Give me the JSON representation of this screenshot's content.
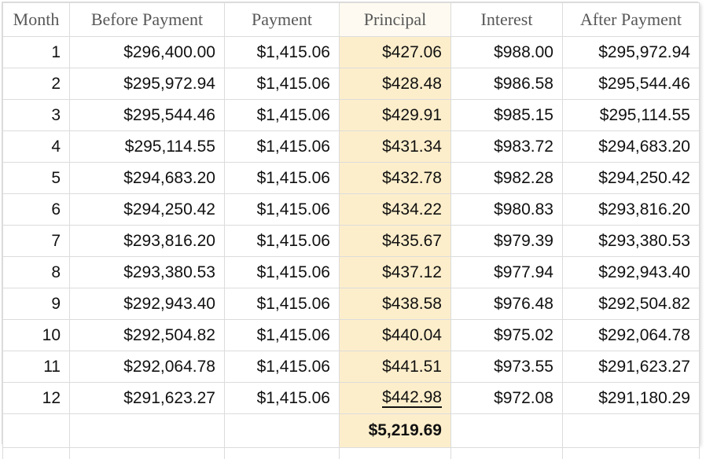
{
  "table": {
    "columns": [
      {
        "key": "month",
        "label": "Month",
        "align": "right",
        "highlight": false
      },
      {
        "key": "before",
        "label": "Before Payment",
        "align": "right",
        "highlight": false
      },
      {
        "key": "payment",
        "label": "Payment",
        "align": "right",
        "highlight": false
      },
      {
        "key": "principal",
        "label": "Principal",
        "align": "right",
        "highlight": true
      },
      {
        "key": "interest",
        "label": "Interest",
        "align": "right",
        "highlight": false
      },
      {
        "key": "after",
        "label": "After Payment",
        "align": "right",
        "highlight": false
      }
    ],
    "rows": [
      {
        "month": "1",
        "before": "$296,400.00",
        "payment": "$1,415.06",
        "principal": "$427.06",
        "interest": "$988.00",
        "after": "$295,972.94"
      },
      {
        "month": "2",
        "before": "$295,972.94",
        "payment": "$1,415.06",
        "principal": "$428.48",
        "interest": "$986.58",
        "after": "$295,544.46"
      },
      {
        "month": "3",
        "before": "$295,544.46",
        "payment": "$1,415.06",
        "principal": "$429.91",
        "interest": "$985.15",
        "after": "$295,114.55"
      },
      {
        "month": "4",
        "before": "$295,114.55",
        "payment": "$1,415.06",
        "principal": "$431.34",
        "interest": "$983.72",
        "after": "$294,683.20"
      },
      {
        "month": "5",
        "before": "$294,683.20",
        "payment": "$1,415.06",
        "principal": "$432.78",
        "interest": "$982.28",
        "after": "$294,250.42"
      },
      {
        "month": "6",
        "before": "$294,250.42",
        "payment": "$1,415.06",
        "principal": "$434.22",
        "interest": "$980.83",
        "after": "$293,816.20"
      },
      {
        "month": "7",
        "before": "$293,816.20",
        "payment": "$1,415.06",
        "principal": "$435.67",
        "interest": "$979.39",
        "after": "$293,380.53"
      },
      {
        "month": "8",
        "before": "$293,380.53",
        "payment": "$1,415.06",
        "principal": "$437.12",
        "interest": "$977.94",
        "after": "$292,943.40"
      },
      {
        "month": "9",
        "before": "$292,943.40",
        "payment": "$1,415.06",
        "principal": "$438.58",
        "interest": "$976.48",
        "after": "$292,504.82"
      },
      {
        "month": "10",
        "before": "$292,504.82",
        "payment": "$1,415.06",
        "principal": "$440.04",
        "interest": "$975.02",
        "after": "$292,064.78"
      },
      {
        "month": "11",
        "before": "$292,064.78",
        "payment": "$1,415.06",
        "principal": "$441.51",
        "interest": "$973.55",
        "after": "$291,623.27"
      },
      {
        "month": "12",
        "before": "$291,623.27",
        "payment": "$1,415.06",
        "principal": "$442.98",
        "interest": "$972.08",
        "after": "$291,180.29"
      }
    ],
    "total_row": {
      "month": "",
      "before": "",
      "payment": "",
      "principal": "$5,219.69",
      "interest": "",
      "after": ""
    }
  },
  "colors": {
    "highlight_fill": "#fdeecb",
    "header_highlight_fill": "#fefaf1",
    "grid_line": "#dcdcdc",
    "header_text": "#575757",
    "body_text": "#111111",
    "sheet_background": "#ffffff"
  }
}
